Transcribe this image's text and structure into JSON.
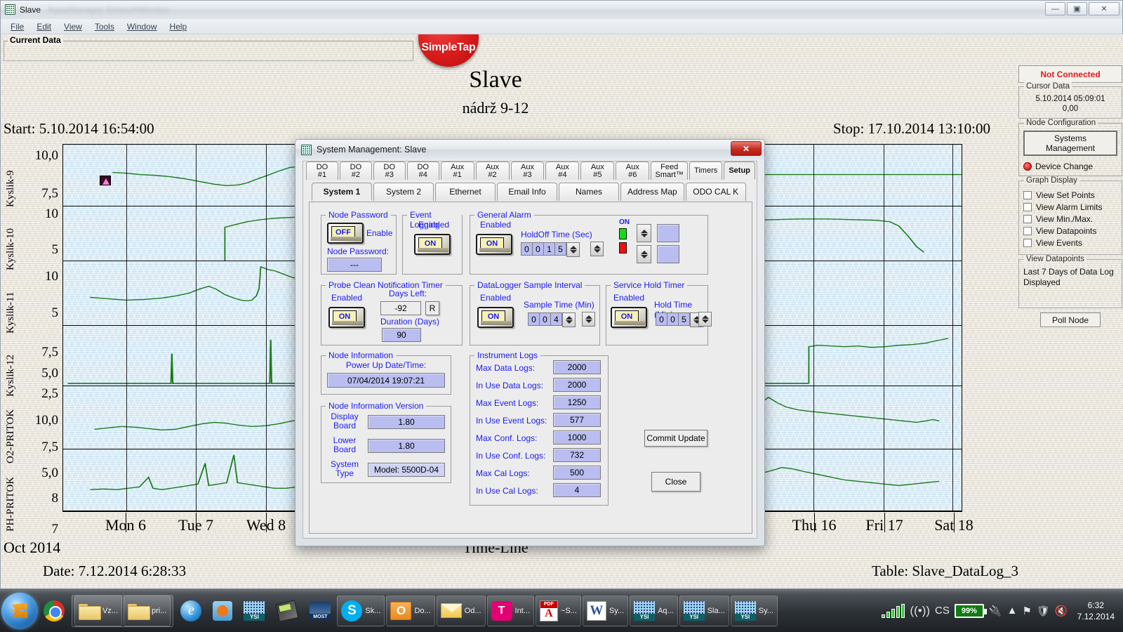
{
  "window": {
    "title": "Slave",
    "title_blurred": "AquaManager NetworkMonitor",
    "minimize": "—",
    "maximize": "▣",
    "close": "✕"
  },
  "menu": [
    "File",
    "Edit",
    "View",
    "Tools",
    "Window",
    "Help"
  ],
  "panel": {
    "current_data_label": "Current Data"
  },
  "logo": {
    "text": "SimpleTap"
  },
  "chart_header": {
    "title": "Slave",
    "subtitle": "nádrž 9-12",
    "start": "Start: 5.10.2014 16:54:00",
    "stop": "Stop: 17.10.2014 13:10:00",
    "timeline_label": "Time-Line",
    "month_year": "Oct 2014",
    "date_footer": "Date: 7.12.2014 6:28:33",
    "table_footer": "Table: Slave_DataLog_3"
  },
  "chart_data": {
    "type": "line",
    "title": "Slave",
    "subtitle": "nádrž 9-12",
    "xlabel": "Time-Line",
    "grid": false,
    "legend": "none",
    "x_range": [
      "5.10.2014 16:54:00",
      "17.10.2014 13:10:00"
    ],
    "x_tick_labels": [
      "Mon 6",
      "Tue 7",
      "Wed 8",
      "Thu 16",
      "Fri 17",
      "Sat 18"
    ],
    "x_tick_positions_pct": [
      7.0,
      14.8,
      22.6,
      83.5,
      91.3,
      99.0
    ],
    "series": [
      {
        "name": "Kyslik-9",
        "ylabel": "Kyslik-9",
        "yticks": [
          10.0,
          7.5
        ],
        "ytick_labels": [
          "10,0",
          "7,5"
        ],
        "ylim": [
          5.5,
          11.0
        ],
        "color": "#1a7a1a"
      },
      {
        "name": "Kyslik-10",
        "ylabel": "Kyslik-10",
        "yticks": [
          10,
          5
        ],
        "ytick_labels": [
          "10",
          "5"
        ],
        "ylim": [
          0,
          12
        ],
        "color": "#1a7a1a"
      },
      {
        "name": "Kyslik-11",
        "ylabel": "Kyslik-11",
        "yticks": [
          10,
          5
        ],
        "ytick_labels": [
          "10",
          "5"
        ],
        "ylim": [
          0,
          12
        ],
        "color": "#1a7a1a"
      },
      {
        "name": "Kyslik-12",
        "ylabel": "Kyslik-12",
        "yticks": [
          7.5,
          5.0,
          2.5
        ],
        "ytick_labels": [
          "7,5",
          "5,0",
          "2,5"
        ],
        "ylim": [
          0,
          9
        ],
        "color": "#1a7a1a"
      },
      {
        "name": "O2-PRITOK",
        "ylabel": "O2-PRITOK",
        "yticks": [
          10.0,
          7.5,
          5.0
        ],
        "ytick_labels": [
          "10,0",
          "7,5",
          "5,0"
        ],
        "ylim": [
          3.5,
          11.5
        ],
        "color": "#1a7a1a"
      },
      {
        "name": "PH-PRITOK",
        "ylabel": "PH-PRITOK",
        "yticks": [
          8,
          7
        ],
        "ytick_labels": [
          "8",
          "7"
        ],
        "ylim": [
          6.4,
          8.6
        ],
        "color": "#1a7a1a"
      }
    ],
    "cursor_marker": {
      "x_pct": 4.0,
      "series": "Kyslik-9"
    }
  },
  "sidebar": {
    "connection_status": "Not Connected",
    "connection_color": "#e01b1b",
    "cursor_data": {
      "legend": "Cursor Data",
      "timestamp": "5.10.2014 05:09:01",
      "value": "0,00"
    },
    "node_configuration": {
      "legend": "Node Configuration",
      "systems_management_line1": "Systems",
      "systems_management_line2": "Management",
      "device_change": "Device Change"
    },
    "graph_display": {
      "legend": "Graph Display",
      "options": [
        {
          "label": "View Set Points",
          "checked": false
        },
        {
          "label": "View Alarm Limits",
          "checked": false
        },
        {
          "label": "View Min./Max.",
          "checked": false
        },
        {
          "label": "View Datapoints",
          "checked": false
        },
        {
          "label": "View Events",
          "checked": false
        }
      ]
    },
    "view_datapoints": {
      "legend": "View Datapoints",
      "text": "Last 7 Days of Data Log Displayed"
    },
    "poll_node": "Poll Node"
  },
  "dialog": {
    "title": "System Management: Slave",
    "close_glyph": "✕",
    "tabs_level1": [
      {
        "label": "DO #1",
        "active": false
      },
      {
        "label": "DO #2",
        "active": false
      },
      {
        "label": "DO #3",
        "active": false
      },
      {
        "label": "DO #4",
        "active": false
      },
      {
        "label": "Aux #1",
        "active": false
      },
      {
        "label": "Aux #2",
        "active": false
      },
      {
        "label": "Aux #3",
        "active": false
      },
      {
        "label": "Aux #4",
        "active": false
      },
      {
        "label": "Aux #5",
        "active": false
      },
      {
        "label": "Aux #6",
        "active": false
      },
      {
        "label": "Feed\nSmart™",
        "active": false
      },
      {
        "label": "Timers",
        "active": false
      },
      {
        "label": "Setup",
        "active": true
      }
    ],
    "tabs_level2": [
      {
        "label": "System 1",
        "active": true
      },
      {
        "label": "System 2",
        "active": false
      },
      {
        "label": "Ethernet",
        "active": false
      },
      {
        "label": "Email Info",
        "active": false
      },
      {
        "label": "Names",
        "active": false
      },
      {
        "label": "Address Map",
        "active": false
      },
      {
        "label": "ODO CAL K",
        "active": false
      }
    ],
    "node_password": {
      "legend": "Node Password",
      "switch_state": "OFF",
      "switch_caption": "Enable",
      "field_label": "Node Password:",
      "field_value": "---"
    },
    "event_logging": {
      "legend": "Event Logging",
      "enabled_label": "Enabled",
      "switch_state": "ON"
    },
    "general_alarm": {
      "legend": "General Alarm",
      "enabled_label": "Enabled",
      "switch_state": "ON",
      "holdoff_label": "HoldOff Time (Sec)",
      "holdoff_digits": [
        "0",
        "0",
        "1",
        "5"
      ],
      "on_label": "ON",
      "led_on_color": "#15dd15",
      "led_off_color": "#ee1111",
      "value_1": "",
      "value_2": ""
    },
    "datalogger": {
      "legend": "DataLogger Sample Interval",
      "enabled_label": "Enabled",
      "switch_state": "ON",
      "sample_label": "Sample Time (Min)",
      "sample_digits": [
        "0",
        "0",
        "4"
      ]
    },
    "service_hold": {
      "legend": "Service Hold Timer",
      "enabled_label": "Enabled",
      "switch_state": "ON",
      "hold_label": "Hold Time (Min)",
      "hold_digits": [
        "0",
        "0",
        "5"
      ]
    },
    "probe_clean": {
      "legend": "Probe Clean Notification Timer",
      "enabled_label": "Enabled",
      "switch_state": "ON",
      "days_left_label": "Days Left:",
      "days_left_value": "-92",
      "reset_button": "R",
      "duration_label": "Duration (Days)",
      "duration_value": "90"
    },
    "node_information": {
      "legend": "Node Information",
      "power_up_label": "Power Up Date/Time:",
      "power_up_value": "07/04/2014 19:07:21"
    },
    "node_information_version": {
      "legend": "Node Information Version",
      "rows": [
        {
          "label_line1": "Display",
          "label_line2": "Board",
          "value": "1.80"
        },
        {
          "label_line1": "Lower",
          "label_line2": "Board",
          "value": "1.80"
        },
        {
          "label_line1": "System",
          "label_line2": "Type",
          "value": "Model: 5500D-04"
        }
      ]
    },
    "instrument_logs": {
      "legend": "Instrument Logs",
      "rows": [
        {
          "label": "Max Data Logs:",
          "value": "2000"
        },
        {
          "label": "In Use Data Logs:",
          "value": "2000"
        },
        {
          "label": "Max Event Logs:",
          "value": "1250"
        },
        {
          "label": "In Use Event Logs:",
          "value": "577"
        },
        {
          "label": "Max Conf. Logs:",
          "value": "1000"
        },
        {
          "label": "In Use Conf. Logs:",
          "value": "732"
        },
        {
          "label": "Max Cal Logs:",
          "value": "500"
        },
        {
          "label": "In Use Cal Logs:",
          "value": "4"
        }
      ]
    },
    "commit_button": "Commit Update",
    "close_button": "Close"
  },
  "taskbar": {
    "pinned": [
      {
        "name": "chrome-icon",
        "label": ""
      }
    ],
    "groups": [
      {
        "items": [
          {
            "icon": "folder-icon",
            "label": "Vz..."
          },
          {
            "icon": "folder-icon",
            "label": "pri..."
          }
        ]
      }
    ],
    "quick": [
      {
        "icon": "ie-icon",
        "label": ""
      },
      {
        "icon": "media-player-icon",
        "label": ""
      },
      {
        "icon": "ysi-icon",
        "label": ""
      },
      {
        "icon": "calculator-icon",
        "label": ""
      },
      {
        "icon": "most-icon",
        "label": ""
      }
    ],
    "buttons": [
      {
        "icon": "skype-icon",
        "label": "Sk..."
      },
      {
        "icon": "outlook-icon",
        "label": "Do..."
      },
      {
        "icon": "mail-icon",
        "label": "Od..."
      },
      {
        "icon": "tmobile-icon",
        "label": "Int..."
      },
      {
        "icon": "pdf-icon",
        "label": "~S..."
      },
      {
        "icon": "word-icon",
        "label": "Sy..."
      },
      {
        "icon": "ysi-icon",
        "label": "Aq..."
      },
      {
        "icon": "ysi-icon",
        "label": "Sla..."
      },
      {
        "icon": "ysi-icon",
        "label": "Sy..."
      }
    ],
    "tray": {
      "signal": "signal-bars-icon",
      "wifi": "wifi-icon",
      "input_language": "CS",
      "battery_percent": "99%",
      "power_plug": "plug-icon",
      "show_hidden": "▲",
      "flag": "flag-icon",
      "shield": "shield-icon",
      "volume": "volume-mute-icon",
      "time": "6:32",
      "date": "7.12.2014"
    }
  }
}
